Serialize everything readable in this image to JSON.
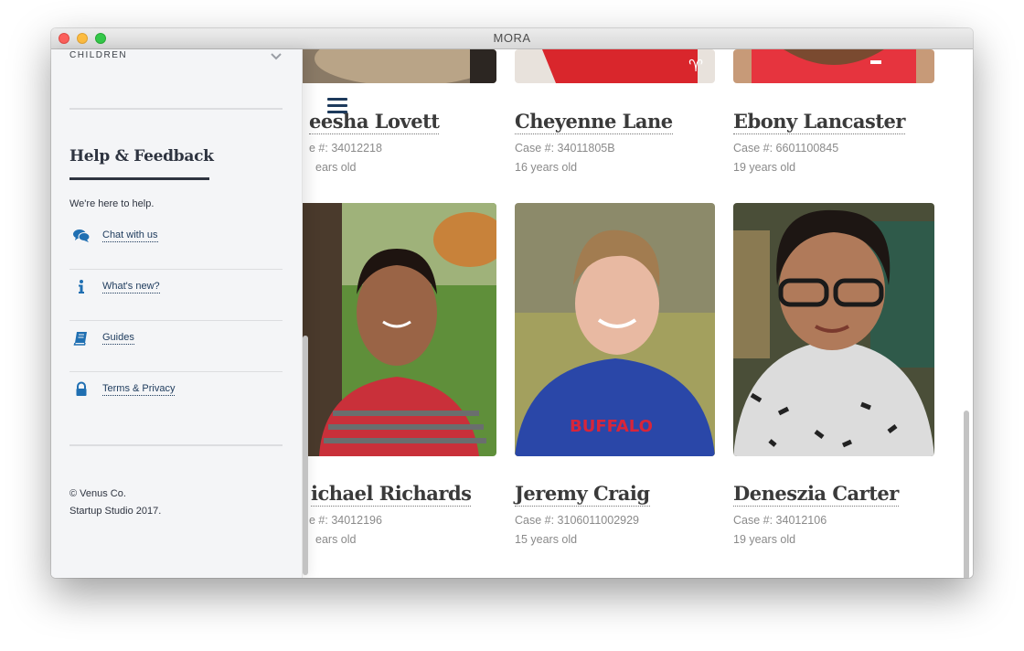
{
  "window": {
    "title": "MORA"
  },
  "sidebar": {
    "section_label": "CHILDREN",
    "help_title": "Help & Feedback",
    "help_subtitle": "We're here to help.",
    "items": [
      {
        "label": "Chat with us",
        "icon": "chat-icon"
      },
      {
        "label": "What's new?",
        "icon": "info-icon"
      },
      {
        "label": "Guides",
        "icon": "book-icon"
      },
      {
        "label": "Terms & Privacy",
        "icon": "lock-icon"
      }
    ],
    "copyright_line1": "© Venus Co.",
    "copyright_line2": "Startup Studio 2017."
  },
  "children": [
    {
      "name": "eesha Lovett",
      "case": "e #: 34012218",
      "age": "ears old"
    },
    {
      "name": "Cheyenne Lane",
      "case": "Case #: 34011805B",
      "age": "16 years old"
    },
    {
      "name": "Ebony Lancaster",
      "case": "Case #: 6601100845",
      "age": "19 years old"
    },
    {
      "name": "ichael Richards",
      "case": "e #: 34012196",
      "age": "ears old"
    },
    {
      "name": "Jeremy Craig",
      "case": "Case #: 3106011002929",
      "age": "15 years old"
    },
    {
      "name": "Deneszia Carter",
      "case": "Case #: 34012106",
      "age": "19 years old"
    }
  ],
  "colors": {
    "accent": "#1d3a5c",
    "icon_blue": "#1f6fb2",
    "sidebar_bg": "#f4f5f7"
  }
}
